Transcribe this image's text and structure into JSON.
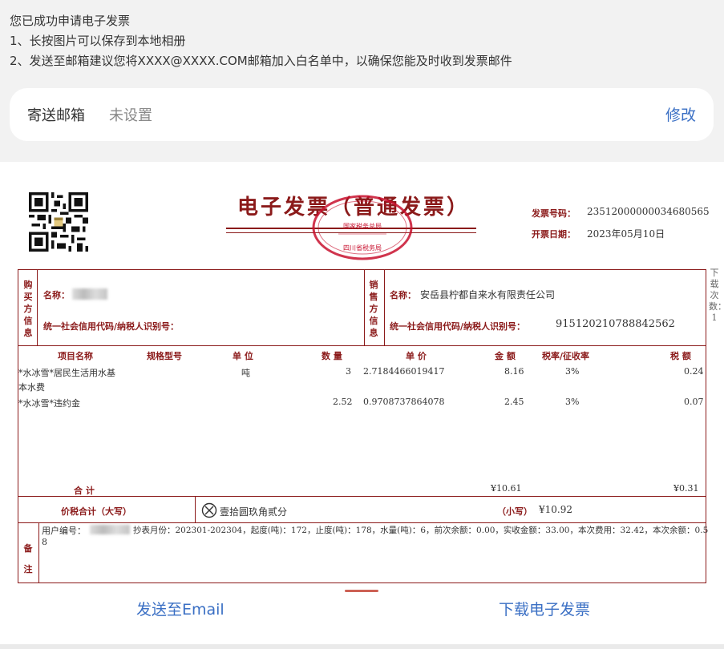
{
  "notice": {
    "line1": "您已成功申请电子发票",
    "line2": "1、长按图片可以保存到本地相册",
    "line3": "2、发送至邮箱建议您将XXXX@XXXX.COM邮箱加入白名单中，以确保您能及时收到发票邮件"
  },
  "email": {
    "label": "寄送邮箱",
    "value": "未设置",
    "edit_label": "修改"
  },
  "invoice": {
    "title": "电子发票（普通发票）",
    "seal_top": "国家税务总局",
    "seal_bottom": "四川省税务局",
    "number_label": "发票号码：",
    "number": "23512000000034680565",
    "date_label": "开票日期：",
    "date": "2023年05月10日",
    "buyer": {
      "section": "购买方信息",
      "name_label": "名称：",
      "tax_label": "统一社会信用代码/纳税人识别号："
    },
    "seller": {
      "section": "销售方信息",
      "name_label": "名称：",
      "name": "安岳县柠都自来水有限责任公司",
      "tax_label": "统一社会信用代码/纳税人识别号：",
      "tax_id": "915120210788842562"
    },
    "headers": {
      "item": "项目名称",
      "spec": "规格型号",
      "unit": "单  位",
      "qty": "数  量",
      "price": "单  价",
      "amount": "金  额",
      "rate": "税率/征收率",
      "tax": "税  额"
    },
    "items": [
      {
        "name1": "*水冰雪*居民生活用水基",
        "name2": "本水费",
        "unit": "吨",
        "qty": "3",
        "price": "2.7184466019417",
        "amount": "8.16",
        "rate": "3%",
        "tax": "0.24"
      },
      {
        "name1": "*水冰雪*违约金",
        "name2": "",
        "unit": "",
        "qty": "2.52",
        "price": "0.9708737864078",
        "amount": "2.45",
        "rate": "3%",
        "tax": "0.07"
      }
    ],
    "total_label": "合        计",
    "total_amount": "¥10.61",
    "total_tax": "¥0.31",
    "grand_label": "价税合计（大写）",
    "grand_words": "壹拾圆玖角贰分",
    "grand_small_label": "（小写）",
    "grand_small": "¥10.92",
    "remarks_label": "备注",
    "remarks_part1": "用户编号：",
    "remarks_part2": "抄表月份：202301-202304，起度(吨)：172，止度(吨)：178，水量(吨)：6，前次余额：0.00，实收金额：33.00，本次费用：32.42，本次余额：0.5",
    "remarks_part3": "8",
    "side_note": "下载次数：1"
  },
  "actions": {
    "send_email": "发送至Email",
    "download": "下载电子发票"
  },
  "colors": {
    "invoice_red": "#8b1a1a",
    "link_blue": "#3a6fc4"
  }
}
